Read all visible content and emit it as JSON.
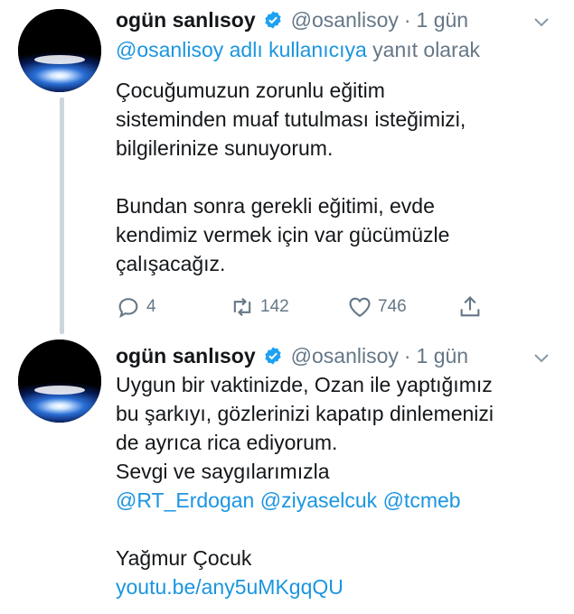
{
  "tweets": [
    {
      "author_name": "ogün sanlısoy",
      "handle": "@osanlisoy",
      "separator": "·",
      "time": "1 gün",
      "reply_to_user": "@osanlisoy adlı kullanıcıya",
      "reply_to_suffix": "yanıt olarak",
      "lines": [
        "Çocuğumuzun zorunlu eğitim",
        "sisteminden muaf tutulması isteğimizi,",
        "bilgilerinize sunuyorum.",
        "",
        "Bundan sonra gerekli eğitimi, evde",
        "kendimiz vermek için var gücümüzle",
        "çalışacağız."
      ],
      "replies": "4",
      "retweets": "142",
      "likes": "746"
    },
    {
      "author_name": "ogün sanlısoy",
      "handle": "@osanlisoy",
      "separator": "·",
      "time": "1 gün",
      "lines": [
        "Uygun bir vaktinizde, Ozan ile yaptığımız",
        "bu şarkıyı, gözlerinizi kapatıp dinlemenizi",
        "de ayrıca rica ediyorum.",
        "Sevgi ve saygılarımızla"
      ],
      "mentions": [
        "@RT_Erdogan",
        "@ziyaselcuk",
        "@tcmeb"
      ],
      "signature": "Yağmur Çocuk",
      "link": "youtu.be/any5uMKgqQU"
    }
  ],
  "icons": {
    "verified": "verified-badge-icon",
    "menu": "chevron-down-icon",
    "reply": "reply-bubble-icon",
    "retweet": "retweet-icon",
    "like": "heart-icon",
    "share": "share-icon"
  },
  "colors": {
    "link": "#1b95e0",
    "muted": "#657786",
    "text": "#14171a",
    "thread_line": "#ccd6dd",
    "verified": "#1da1f2"
  }
}
